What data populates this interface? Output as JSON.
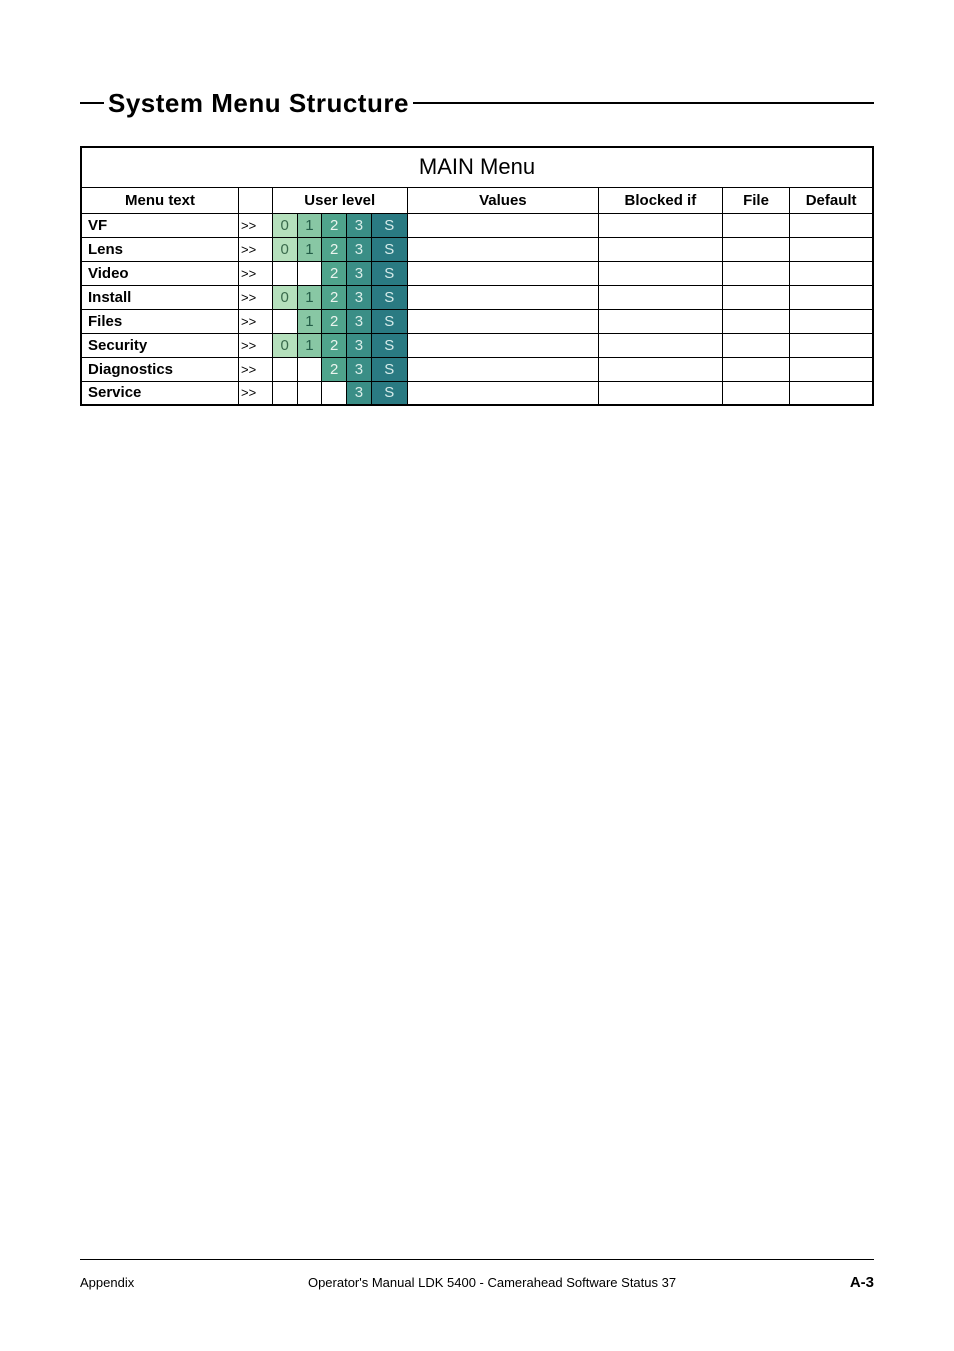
{
  "section_title": "System  Menu  Structure",
  "table": {
    "title": "MAIN Menu",
    "headers": {
      "menu_text": "Menu text",
      "arrow_spacer": "",
      "user_level": "User level",
      "values": "Values",
      "blocked_if": "Blocked if",
      "file": "File",
      "default": "Default"
    },
    "level_glyphs": {
      "0": "0",
      "1": "1",
      "2": "2",
      "3": "3",
      "S": "S"
    },
    "arrow_glyph": ">>",
    "rows": [
      {
        "label": "VF",
        "arrow": true,
        "levels": [
          "0",
          "1",
          "2",
          "3",
          "S"
        ],
        "values": "",
        "blocked_if": "",
        "file": "",
        "default": ""
      },
      {
        "label": "Lens",
        "arrow": true,
        "levels": [
          "0",
          "1",
          "2",
          "3",
          "S"
        ],
        "values": "",
        "blocked_if": "",
        "file": "",
        "default": ""
      },
      {
        "label": "Video",
        "arrow": true,
        "levels": [
          "2",
          "3",
          "S"
        ],
        "values": "",
        "blocked_if": "",
        "file": "",
        "default": ""
      },
      {
        "label": "Install",
        "arrow": true,
        "levels": [
          "0",
          "1",
          "2",
          "3",
          "S"
        ],
        "values": "",
        "blocked_if": "",
        "file": "",
        "default": ""
      },
      {
        "label": "Files",
        "arrow": true,
        "levels": [
          "1",
          "2",
          "3",
          "S"
        ],
        "values": "",
        "blocked_if": "",
        "file": "",
        "default": ""
      },
      {
        "label": "Security",
        "arrow": true,
        "levels": [
          "0",
          "1",
          "2",
          "3",
          "S"
        ],
        "values": "",
        "blocked_if": "",
        "file": "",
        "default": ""
      },
      {
        "label": "Diagnostics",
        "arrow": true,
        "levels": [
          "2",
          "3",
          "S"
        ],
        "values": "",
        "blocked_if": "",
        "file": "",
        "default": ""
      },
      {
        "label": "Service",
        "arrow": true,
        "levels": [
          "3",
          "S"
        ],
        "values": "",
        "blocked_if": "",
        "file": "",
        "default": ""
      }
    ]
  },
  "footer": {
    "left": "Appendix",
    "center": "Operator's Manual LDK 5400 - Camerahead Software Status 37",
    "right": "A-3"
  }
}
